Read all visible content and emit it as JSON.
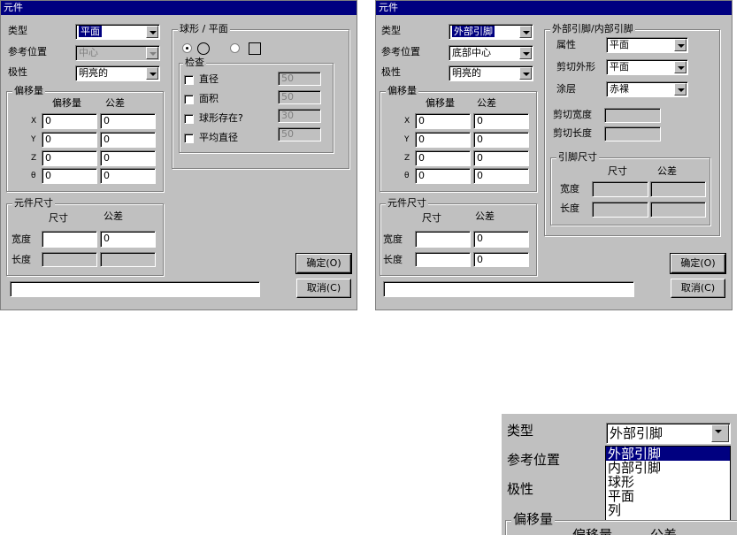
{
  "left_dialog": {
    "title": "元件",
    "type_label": "类型",
    "type_value": "平面",
    "ref_label": "参考位置",
    "ref_value": "中心",
    "polarity_label": "极性",
    "polarity_value": "明亮的",
    "offset_group": "偏移量",
    "offset_col": "偏移量",
    "tol_col": "公差",
    "axes": [
      "X",
      "Y",
      "Z",
      "θ"
    ],
    "offset_vals": [
      "0",
      "0",
      "0",
      "0"
    ],
    "tol_vals": [
      "0",
      "0",
      "0",
      "0"
    ],
    "size_group": "元件尺寸",
    "size_col": "尺寸",
    "size_tol_col": "公差",
    "width_label": "宽度",
    "length_label": "长度",
    "width_tol": "0",
    "ball_group": "球形 / 平面",
    "check_group": "检查",
    "checks": [
      "直径",
      "面积",
      "球形存在?",
      "平均直径"
    ],
    "check_vals": [
      "50",
      "50",
      "30",
      "50"
    ],
    "ok": "确定(O)",
    "cancel": "取消(C)"
  },
  "right_dialog": {
    "title": "元件",
    "type_label": "类型",
    "type_value": "外部引脚",
    "ref_label": "参考位置",
    "ref_value": "底部中心",
    "polarity_label": "极性",
    "polarity_value": "明亮的",
    "offset_group": "偏移量",
    "offset_col": "偏移量",
    "tol_col": "公差",
    "axes": [
      "X",
      "Y",
      "Z",
      "θ"
    ],
    "offset_vals": [
      "0",
      "0",
      "0",
      "0"
    ],
    "tol_vals": [
      "0",
      "0",
      "0",
      "0"
    ],
    "size_group": "元件尺寸",
    "size_col": "尺寸",
    "size_tol_col": "公差",
    "width_label": "宽度",
    "length_label": "长度",
    "width_tol": "0",
    "length_tol": "0",
    "lead_group": "外部引脚/内部引脚",
    "attr_label": "属性",
    "attr_value": "平面",
    "cut_label": "剪切外形",
    "cut_value": "平面",
    "coat_label": "涂层",
    "coat_value": "赤裸",
    "cut_w_label": "剪切宽度",
    "cut_l_label": "剪切长度",
    "pin_group": "引脚尺寸",
    "pin_size": "尺寸",
    "pin_tol": "公差",
    "pin_w": "宽度",
    "pin_l": "长度",
    "ok": "确定(O)",
    "cancel": "取消(C)"
  },
  "zoom": {
    "type_label": "类型",
    "type_value": "外部引脚",
    "ref_label": "参考位置",
    "polarity_label": "极性",
    "offset_group": "偏移量",
    "options": [
      "外部引脚",
      "内部引脚",
      "球形",
      "平面",
      "列"
    ],
    "cut_text_1": "偏移量",
    "cut_text_2": "公差"
  }
}
